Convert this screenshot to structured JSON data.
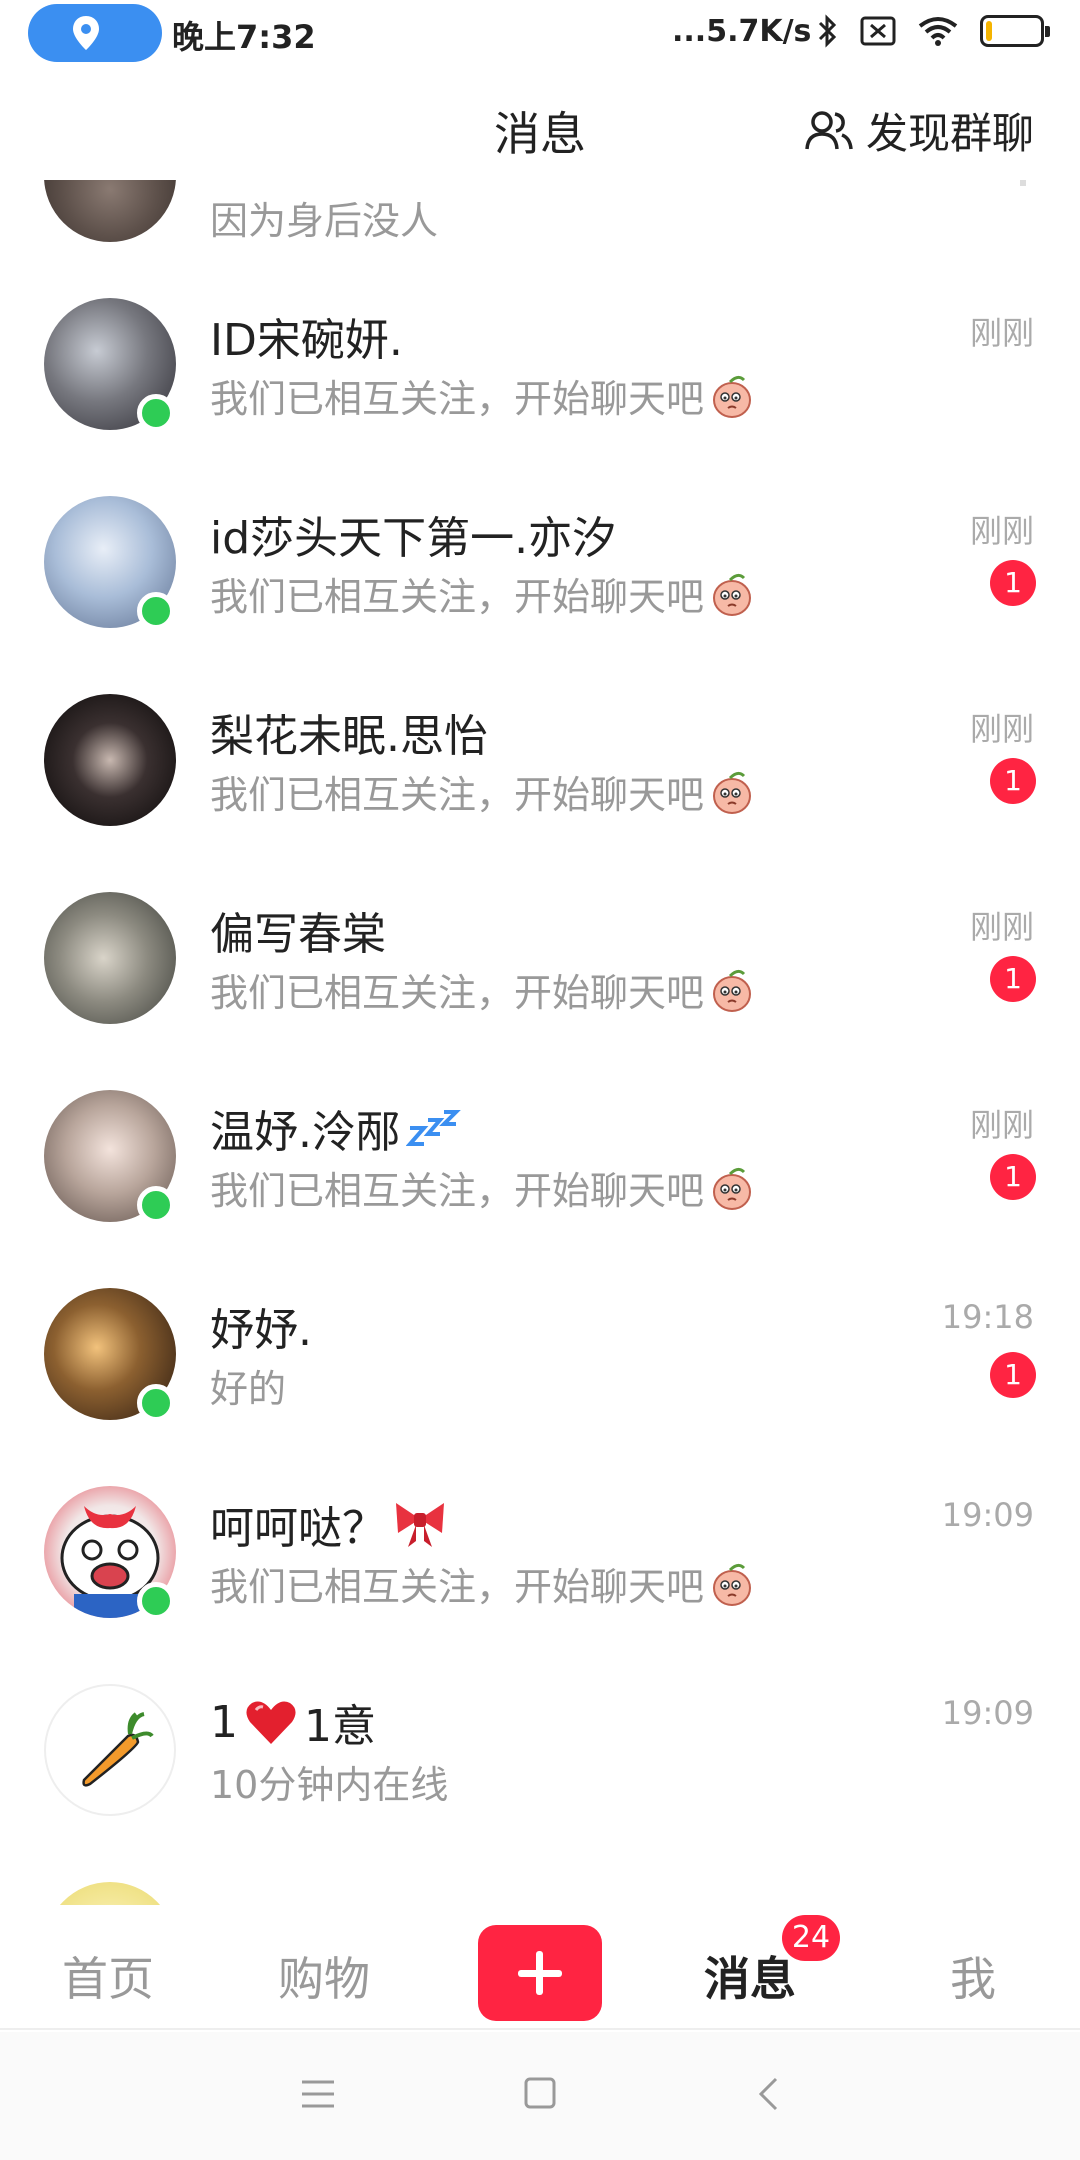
{
  "status_bar": {
    "time": "晚上7:32",
    "network_speed": "...5.7K/s",
    "icons": [
      "location-icon",
      "bluetooth-icon",
      "sim-icon",
      "wifi-icon",
      "battery-icon"
    ],
    "battery_level": 0.12
  },
  "header": {
    "title": "消息",
    "discover_label": "发现群聊"
  },
  "conversations": [
    {
      "name": "",
      "preview": "因为身后没人",
      "time": "",
      "unread": "",
      "online": false,
      "pinned": true
    },
    {
      "name": "ID宋碗妍.",
      "preview": "我们已相互关注，开始聊天吧",
      "time": "刚刚",
      "unread": "",
      "online": true
    },
    {
      "name": "id莎头天下第一.亦汐",
      "preview": "我们已相互关注，开始聊天吧",
      "time": "刚刚",
      "unread": "1",
      "online": true
    },
    {
      "name": "梨花未眠.思怡",
      "preview": "我们已相互关注，开始聊天吧",
      "time": "刚刚",
      "unread": "1",
      "online": false
    },
    {
      "name": "偏写春棠",
      "preview": "我们已相互关注，开始聊天吧",
      "time": "刚刚",
      "unread": "1",
      "online": false
    },
    {
      "name": "温妤.泠邴",
      "preview": "我们已相互关注，开始聊天吧",
      "time": "刚刚",
      "unread": "1",
      "online": true
    },
    {
      "name": "妤妤.",
      "preview": "好的",
      "time": "19:18",
      "unread": "1",
      "online": true
    },
    {
      "name": "呵呵哒？",
      "preview": "我们已相互关注，开始聊天吧",
      "time": "19:09",
      "unread": "",
      "online": true
    },
    {
      "name_part1": "1",
      "name_part2": "1意",
      "preview": "10分钟内在线",
      "time": "19:09",
      "unread": "",
      "online": false
    }
  ],
  "bottom_nav": {
    "items": [
      "首页",
      "购物",
      "消息",
      "我"
    ],
    "active": "消息",
    "message_badge": "24"
  },
  "colors": {
    "accent": "#ff2442",
    "online": "#2ecc55",
    "location_pill": "#3b8ff1"
  }
}
